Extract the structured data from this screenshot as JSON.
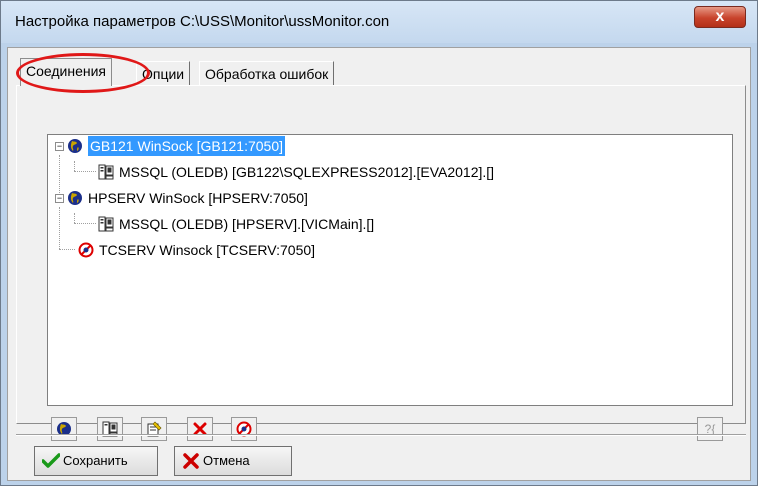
{
  "window": {
    "title": "Настройка параметров C:\\USS\\Monitor\\ussMonitor.con",
    "close_glyph": "x"
  },
  "tabs": [
    {
      "label": "Соединения",
      "active": true
    },
    {
      "label": "Опции",
      "active": false
    },
    {
      "label": "Обработка ошибок",
      "active": false
    }
  ],
  "tree": {
    "nodes": [
      {
        "label": "GB121 WinSock [GB121:7050]",
        "icon": "globe-icon",
        "level": 0,
        "expanded": true,
        "selected": true
      },
      {
        "label": "MSSQL (OLEDB) [GB122\\SQLEXPRESS2012].[EVA2012].[]",
        "icon": "server-icon",
        "level": 1
      },
      {
        "label": "HPSERV WinSock [HPSERV:7050]",
        "icon": "globe-icon",
        "level": 0,
        "expanded": true
      },
      {
        "label": "MSSQL (OLEDB) [HPSERV].[VICMain].[]",
        "icon": "server-icon",
        "level": 1
      },
      {
        "label": "TCSERV Winsock [TCSERV:7050]",
        "icon": "disconnected-icon",
        "level": 0
      }
    ]
  },
  "toolbar": {
    "buttons": [
      {
        "name": "add-connection-button",
        "icon": "globe-icon"
      },
      {
        "name": "add-database-button",
        "icon": "server-icon"
      },
      {
        "name": "edit-properties-button",
        "icon": "document-edit-icon"
      },
      {
        "name": "delete-button",
        "icon": "red-x-icon"
      },
      {
        "name": "disable-button",
        "icon": "disconnected-icon"
      }
    ],
    "help_button": {
      "icon": "help-icon",
      "text": "?{"
    }
  },
  "footer": {
    "save_label": "Сохранить",
    "cancel_label": "Отмена"
  },
  "colors": {
    "selection": "#3399ff",
    "highlight_circle": "#e01818",
    "title_bar": "#c4d8ee",
    "close_button": "#c8432c"
  }
}
